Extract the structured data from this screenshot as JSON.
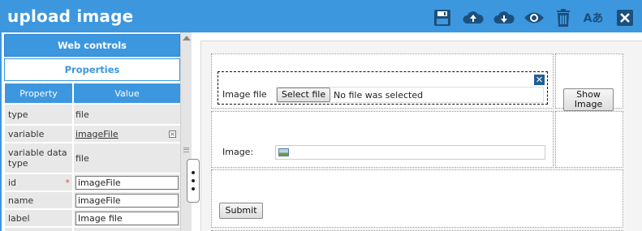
{
  "app": {
    "title": "upload image"
  },
  "toolbar": {
    "icons": [
      "save-icon",
      "upload-cloud-icon",
      "download-cloud-icon",
      "eye-icon",
      "trash-icon",
      "translate-icon",
      "close-icon"
    ],
    "translate_label": "Aあ",
    "color": "#3c97df"
  },
  "left_panel": {
    "web_controls": "Web controls",
    "properties": "Properties",
    "table": {
      "headers": {
        "property": "Property",
        "value": "Value"
      },
      "rows": [
        {
          "property": "type",
          "value": "file"
        },
        {
          "property": "variable",
          "value": "imageFile"
        },
        {
          "property": "variable data type",
          "value": "file"
        },
        {
          "property": "id",
          "value": "imageFile",
          "required": "*"
        },
        {
          "property": "name",
          "value": "imageFile"
        },
        {
          "property": "label",
          "value": "Image file"
        }
      ]
    }
  },
  "form": {
    "file_label": "Image file",
    "select_button": "Select file",
    "no_file_text": "No file was selected",
    "show_image_button": "Show Image",
    "image_label": "Image:",
    "submit_button": "Submit",
    "close_glyph": "✕"
  }
}
